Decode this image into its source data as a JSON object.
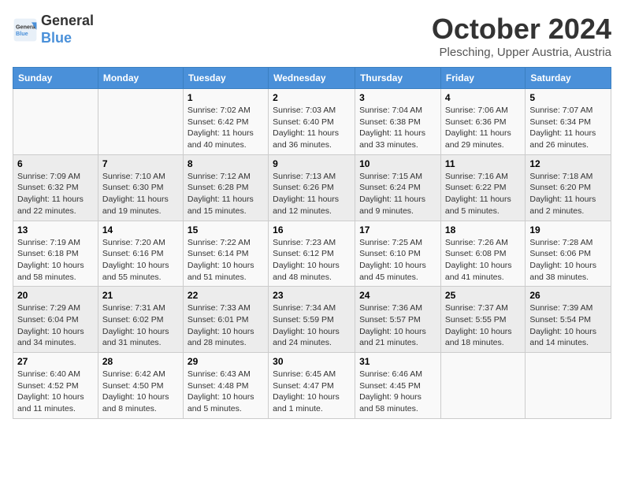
{
  "header": {
    "logo_general": "General",
    "logo_blue": "Blue",
    "month": "October 2024",
    "location": "Plesching, Upper Austria, Austria"
  },
  "weekdays": [
    "Sunday",
    "Monday",
    "Tuesday",
    "Wednesday",
    "Thursday",
    "Friday",
    "Saturday"
  ],
  "weeks": [
    [
      {
        "day": "",
        "info": ""
      },
      {
        "day": "",
        "info": ""
      },
      {
        "day": "1",
        "info": "Sunrise: 7:02 AM\nSunset: 6:42 PM\nDaylight: 11 hours and 40 minutes."
      },
      {
        "day": "2",
        "info": "Sunrise: 7:03 AM\nSunset: 6:40 PM\nDaylight: 11 hours and 36 minutes."
      },
      {
        "day": "3",
        "info": "Sunrise: 7:04 AM\nSunset: 6:38 PM\nDaylight: 11 hours and 33 minutes."
      },
      {
        "day": "4",
        "info": "Sunrise: 7:06 AM\nSunset: 6:36 PM\nDaylight: 11 hours and 29 minutes."
      },
      {
        "day": "5",
        "info": "Sunrise: 7:07 AM\nSunset: 6:34 PM\nDaylight: 11 hours and 26 minutes."
      }
    ],
    [
      {
        "day": "6",
        "info": "Sunrise: 7:09 AM\nSunset: 6:32 PM\nDaylight: 11 hours and 22 minutes."
      },
      {
        "day": "7",
        "info": "Sunrise: 7:10 AM\nSunset: 6:30 PM\nDaylight: 11 hours and 19 minutes."
      },
      {
        "day": "8",
        "info": "Sunrise: 7:12 AM\nSunset: 6:28 PM\nDaylight: 11 hours and 15 minutes."
      },
      {
        "day": "9",
        "info": "Sunrise: 7:13 AM\nSunset: 6:26 PM\nDaylight: 11 hours and 12 minutes."
      },
      {
        "day": "10",
        "info": "Sunrise: 7:15 AM\nSunset: 6:24 PM\nDaylight: 11 hours and 9 minutes."
      },
      {
        "day": "11",
        "info": "Sunrise: 7:16 AM\nSunset: 6:22 PM\nDaylight: 11 hours and 5 minutes."
      },
      {
        "day": "12",
        "info": "Sunrise: 7:18 AM\nSunset: 6:20 PM\nDaylight: 11 hours and 2 minutes."
      }
    ],
    [
      {
        "day": "13",
        "info": "Sunrise: 7:19 AM\nSunset: 6:18 PM\nDaylight: 10 hours and 58 minutes."
      },
      {
        "day": "14",
        "info": "Sunrise: 7:20 AM\nSunset: 6:16 PM\nDaylight: 10 hours and 55 minutes."
      },
      {
        "day": "15",
        "info": "Sunrise: 7:22 AM\nSunset: 6:14 PM\nDaylight: 10 hours and 51 minutes."
      },
      {
        "day": "16",
        "info": "Sunrise: 7:23 AM\nSunset: 6:12 PM\nDaylight: 10 hours and 48 minutes."
      },
      {
        "day": "17",
        "info": "Sunrise: 7:25 AM\nSunset: 6:10 PM\nDaylight: 10 hours and 45 minutes."
      },
      {
        "day": "18",
        "info": "Sunrise: 7:26 AM\nSunset: 6:08 PM\nDaylight: 10 hours and 41 minutes."
      },
      {
        "day": "19",
        "info": "Sunrise: 7:28 AM\nSunset: 6:06 PM\nDaylight: 10 hours and 38 minutes."
      }
    ],
    [
      {
        "day": "20",
        "info": "Sunrise: 7:29 AM\nSunset: 6:04 PM\nDaylight: 10 hours and 34 minutes."
      },
      {
        "day": "21",
        "info": "Sunrise: 7:31 AM\nSunset: 6:02 PM\nDaylight: 10 hours and 31 minutes."
      },
      {
        "day": "22",
        "info": "Sunrise: 7:33 AM\nSunset: 6:01 PM\nDaylight: 10 hours and 28 minutes."
      },
      {
        "day": "23",
        "info": "Sunrise: 7:34 AM\nSunset: 5:59 PM\nDaylight: 10 hours and 24 minutes."
      },
      {
        "day": "24",
        "info": "Sunrise: 7:36 AM\nSunset: 5:57 PM\nDaylight: 10 hours and 21 minutes."
      },
      {
        "day": "25",
        "info": "Sunrise: 7:37 AM\nSunset: 5:55 PM\nDaylight: 10 hours and 18 minutes."
      },
      {
        "day": "26",
        "info": "Sunrise: 7:39 AM\nSunset: 5:54 PM\nDaylight: 10 hours and 14 minutes."
      }
    ],
    [
      {
        "day": "27",
        "info": "Sunrise: 6:40 AM\nSunset: 4:52 PM\nDaylight: 10 hours and 11 minutes."
      },
      {
        "day": "28",
        "info": "Sunrise: 6:42 AM\nSunset: 4:50 PM\nDaylight: 10 hours and 8 minutes."
      },
      {
        "day": "29",
        "info": "Sunrise: 6:43 AM\nSunset: 4:48 PM\nDaylight: 10 hours and 5 minutes."
      },
      {
        "day": "30",
        "info": "Sunrise: 6:45 AM\nSunset: 4:47 PM\nDaylight: 10 hours and 1 minute."
      },
      {
        "day": "31",
        "info": "Sunrise: 6:46 AM\nSunset: 4:45 PM\nDaylight: 9 hours and 58 minutes."
      },
      {
        "day": "",
        "info": ""
      },
      {
        "day": "",
        "info": ""
      }
    ]
  ]
}
